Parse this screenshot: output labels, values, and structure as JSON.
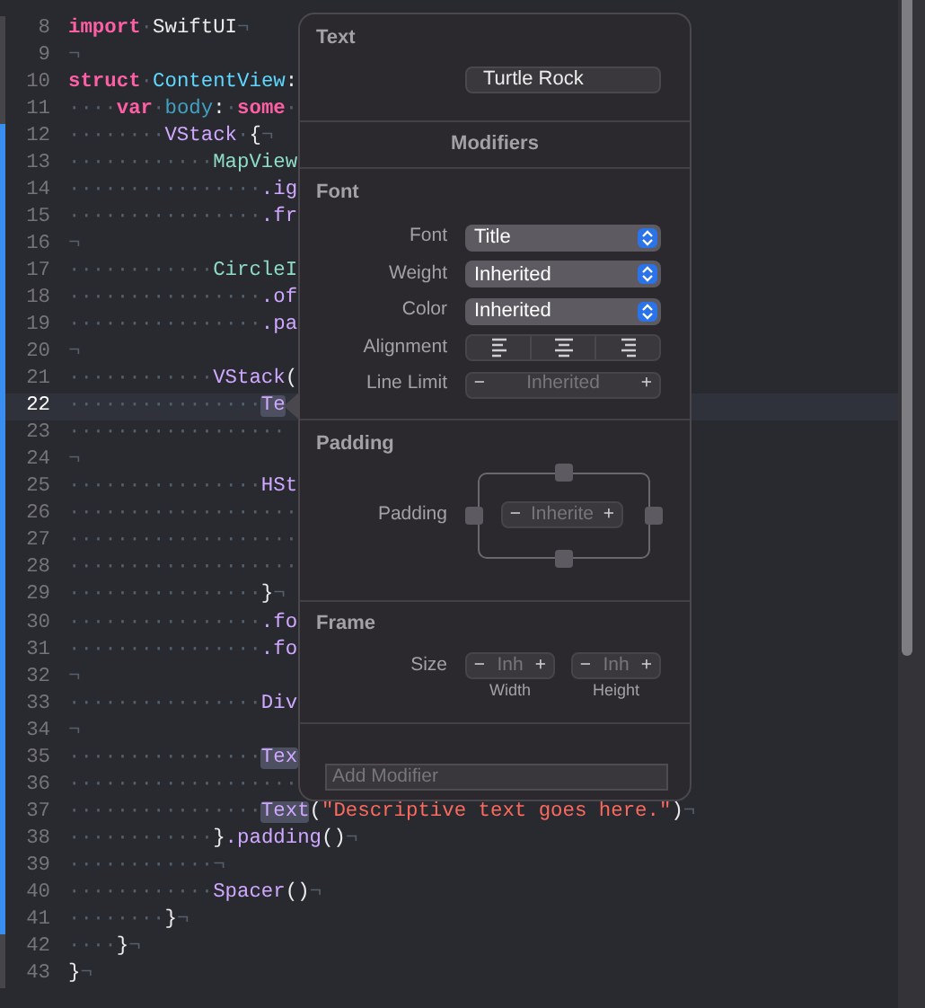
{
  "editor": {
    "lines": [
      {
        "number": "8",
        "current": false,
        "changed": false,
        "segments": [
          {
            "kind": "keyword",
            "text": "import"
          },
          {
            "kind": "invisible",
            "text": "·"
          },
          {
            "kind": "plain",
            "text": "SwiftUI"
          },
          {
            "kind": "invisible",
            "text": "¬"
          }
        ]
      },
      {
        "number": "9",
        "current": false,
        "changed": false,
        "segments": [
          {
            "kind": "invisible",
            "text": "¬"
          }
        ]
      },
      {
        "number": "10",
        "current": false,
        "changed": false,
        "segments": [
          {
            "kind": "keyword",
            "text": "struct"
          },
          {
            "kind": "invisible",
            "text": "·"
          },
          {
            "kind": "declared_type",
            "text": "ContentView"
          },
          {
            "kind": "plain",
            "text": ":"
          }
        ]
      },
      {
        "number": "11",
        "current": false,
        "changed": false,
        "segments": [
          {
            "kind": "invisible",
            "text": "····"
          },
          {
            "kind": "keyword",
            "text": "var"
          },
          {
            "kind": "invisible",
            "text": "·"
          },
          {
            "kind": "declared_name",
            "text": "body"
          },
          {
            "kind": "plain",
            "text": ":"
          },
          {
            "kind": "invisible",
            "text": "·"
          },
          {
            "kind": "keyword",
            "text": "some"
          },
          {
            "kind": "invisible",
            "text": "·"
          }
        ]
      },
      {
        "number": "12",
        "current": false,
        "changed": true,
        "segments": [
          {
            "kind": "invisible",
            "text": "········"
          },
          {
            "kind": "system",
            "text": "VStack"
          },
          {
            "kind": "invisible",
            "text": "·"
          },
          {
            "kind": "plain",
            "text": "{"
          },
          {
            "kind": "invisible",
            "text": "¬"
          }
        ]
      },
      {
        "number": "13",
        "current": false,
        "changed": true,
        "segments": [
          {
            "kind": "invisible",
            "text": "············"
          },
          {
            "kind": "project",
            "text": "MapView"
          }
        ]
      },
      {
        "number": "14",
        "current": false,
        "changed": true,
        "segments": [
          {
            "kind": "invisible",
            "text": "················"
          },
          {
            "kind": "system",
            "text": ".ig"
          }
        ]
      },
      {
        "number": "15",
        "current": false,
        "changed": true,
        "segments": [
          {
            "kind": "invisible",
            "text": "················"
          },
          {
            "kind": "system",
            "text": ".fr"
          }
        ]
      },
      {
        "number": "16",
        "current": false,
        "changed": true,
        "segments": [
          {
            "kind": "invisible",
            "text": "¬"
          }
        ]
      },
      {
        "number": "17",
        "current": false,
        "changed": true,
        "segments": [
          {
            "kind": "invisible",
            "text": "············"
          },
          {
            "kind": "project",
            "text": "CircleI"
          }
        ]
      },
      {
        "number": "18",
        "current": false,
        "changed": true,
        "segments": [
          {
            "kind": "invisible",
            "text": "················"
          },
          {
            "kind": "system",
            "text": ".of"
          }
        ]
      },
      {
        "number": "19",
        "current": false,
        "changed": true,
        "segments": [
          {
            "kind": "invisible",
            "text": "················"
          },
          {
            "kind": "system",
            "text": ".pa"
          }
        ]
      },
      {
        "number": "20",
        "current": false,
        "changed": true,
        "segments": [
          {
            "kind": "invisible",
            "text": "¬"
          }
        ]
      },
      {
        "number": "21",
        "current": false,
        "changed": true,
        "segments": [
          {
            "kind": "invisible",
            "text": "············"
          },
          {
            "kind": "system",
            "text": "VStack"
          },
          {
            "kind": "plain",
            "text": "("
          }
        ]
      },
      {
        "number": "22",
        "current": true,
        "changed": true,
        "segments": [
          {
            "kind": "invisible",
            "text": "················"
          },
          {
            "kind": "match",
            "text": "Te"
          }
        ]
      },
      {
        "number": "23",
        "current": false,
        "changed": true,
        "segments": [
          {
            "kind": "invisible",
            "text": "··················"
          }
        ]
      },
      {
        "number": "24",
        "current": false,
        "changed": true,
        "segments": [
          {
            "kind": "invisible",
            "text": "¬"
          }
        ]
      },
      {
        "number": "25",
        "current": false,
        "changed": true,
        "segments": [
          {
            "kind": "invisible",
            "text": "················"
          },
          {
            "kind": "system",
            "text": "HSt"
          }
        ]
      },
      {
        "number": "26",
        "current": false,
        "changed": true,
        "segments": [
          {
            "kind": "invisible",
            "text": "···················"
          }
        ]
      },
      {
        "number": "27",
        "current": false,
        "changed": true,
        "segments": [
          {
            "kind": "invisible",
            "text": "···················"
          }
        ]
      },
      {
        "number": "28",
        "current": false,
        "changed": true,
        "segments": [
          {
            "kind": "invisible",
            "text": "···················"
          }
        ]
      },
      {
        "number": "29",
        "current": false,
        "changed": true,
        "segments": [
          {
            "kind": "invisible",
            "text": "················"
          },
          {
            "kind": "plain",
            "text": "}"
          },
          {
            "kind": "invisible",
            "text": "¬"
          }
        ]
      },
      {
        "number": "30",
        "current": false,
        "changed": true,
        "segments": [
          {
            "kind": "invisible",
            "text": "················"
          },
          {
            "kind": "system",
            "text": ".fo"
          }
        ]
      },
      {
        "number": "31",
        "current": false,
        "changed": true,
        "segments": [
          {
            "kind": "invisible",
            "text": "················"
          },
          {
            "kind": "system",
            "text": ".fo"
          }
        ]
      },
      {
        "number": "32",
        "current": false,
        "changed": true,
        "segments": [
          {
            "kind": "invisible",
            "text": "¬"
          }
        ]
      },
      {
        "number": "33",
        "current": false,
        "changed": true,
        "segments": [
          {
            "kind": "invisible",
            "text": "················"
          },
          {
            "kind": "system",
            "text": "Div"
          }
        ]
      },
      {
        "number": "34",
        "current": false,
        "changed": true,
        "segments": [
          {
            "kind": "invisible",
            "text": "¬"
          }
        ]
      },
      {
        "number": "35",
        "current": false,
        "changed": true,
        "segments": [
          {
            "kind": "invisible",
            "text": "················"
          },
          {
            "kind": "match",
            "text": "Tex"
          }
        ]
      },
      {
        "number": "36",
        "current": false,
        "changed": true,
        "segments": [
          {
            "kind": "invisible",
            "text": "···················"
          }
        ]
      },
      {
        "number": "37",
        "current": false,
        "changed": true,
        "segments": [
          {
            "kind": "invisible",
            "text": "················"
          },
          {
            "kind": "match",
            "text": "Text"
          },
          {
            "kind": "plain",
            "text": "("
          },
          {
            "kind": "string",
            "text": "\"Descriptive text goes here.\""
          },
          {
            "kind": "plain",
            "text": ")"
          },
          {
            "kind": "invisible",
            "text": "¬"
          }
        ]
      },
      {
        "number": "38",
        "current": false,
        "changed": true,
        "segments": [
          {
            "kind": "invisible",
            "text": "············"
          },
          {
            "kind": "plain",
            "text": "}"
          },
          {
            "kind": "system",
            "text": ".padding"
          },
          {
            "kind": "plain",
            "text": "()"
          },
          {
            "kind": "invisible",
            "text": "¬"
          }
        ]
      },
      {
        "number": "39",
        "current": false,
        "changed": true,
        "segments": [
          {
            "kind": "invisible",
            "text": "············¬"
          }
        ]
      },
      {
        "number": "40",
        "current": false,
        "changed": true,
        "segments": [
          {
            "kind": "invisible",
            "text": "············"
          },
          {
            "kind": "system",
            "text": "Spacer"
          },
          {
            "kind": "plain",
            "text": "()"
          },
          {
            "kind": "invisible",
            "text": "¬"
          }
        ]
      },
      {
        "number": "41",
        "current": false,
        "changed": true,
        "segments": [
          {
            "kind": "invisible",
            "text": "········"
          },
          {
            "kind": "plain",
            "text": "}"
          },
          {
            "kind": "invisible",
            "text": "¬"
          }
        ]
      },
      {
        "number": "42",
        "current": false,
        "changed": false,
        "segments": [
          {
            "kind": "invisible",
            "text": "····"
          },
          {
            "kind": "plain",
            "text": "}"
          },
          {
            "kind": "invisible",
            "text": "¬"
          }
        ]
      },
      {
        "number": "43",
        "current": false,
        "changed": false,
        "segments": [
          {
            "kind": "plain",
            "text": "}"
          },
          {
            "kind": "invisible",
            "text": "¬"
          }
        ]
      }
    ]
  },
  "inspector": {
    "text_section": {
      "title": "Text",
      "value": "Turtle Rock"
    },
    "modifiers_header": "Modifiers",
    "font_section": {
      "title": "Font",
      "rows": [
        {
          "kind": "popup",
          "label": "Font",
          "value": "Title"
        },
        {
          "kind": "popup",
          "label": "Weight",
          "value": "Inherited"
        },
        {
          "kind": "popup",
          "label": "Color",
          "value": "Inherited"
        },
        {
          "kind": "alignment",
          "label": "Alignment",
          "options": [
            {
              "selected": false
            },
            {
              "selected": false
            },
            {
              "selected": false
            }
          ]
        },
        {
          "kind": "stepper",
          "label": "Line Limit",
          "minus": "−",
          "placeholder": "Inherited",
          "plus": "+"
        }
      ]
    },
    "padding_section": {
      "title": "Padding",
      "label": "Padding",
      "edges": {
        "top": {
          "checked": false
        },
        "left": {
          "checked": false
        },
        "right": {
          "checked": false
        },
        "bottom": {
          "checked": false
        }
      },
      "stepper": {
        "minus": "−",
        "placeholder": "Inherite",
        "plus": "+"
      }
    },
    "frame_section": {
      "title": "Frame",
      "label": "Size",
      "fields": [
        {
          "minus": "−",
          "placeholder": "Inh",
          "plus": "+",
          "caption": "Width"
        },
        {
          "minus": "−",
          "placeholder": "Inh",
          "plus": "+",
          "caption": "Height"
        }
      ]
    },
    "add_modifier": {
      "placeholder": "Add Modifier"
    }
  }
}
